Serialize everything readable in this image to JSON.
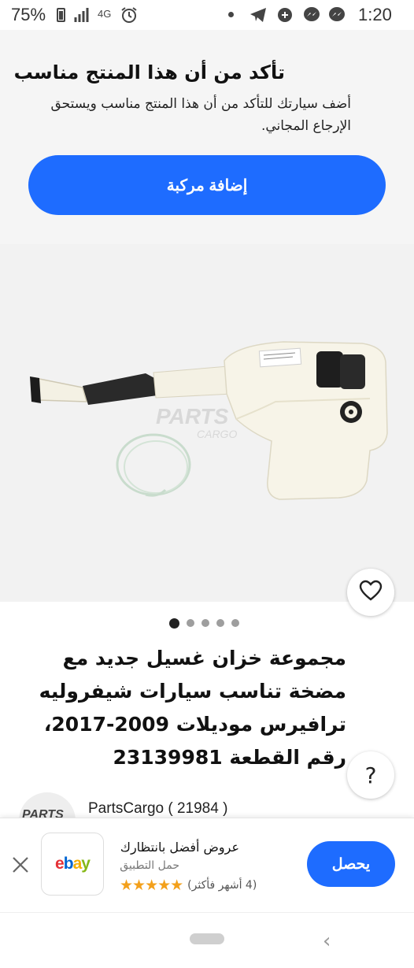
{
  "status_bar": {
    "battery": "75%",
    "network": "4G",
    "time": "1:20"
  },
  "fitment": {
    "title": "تأكد من أن هذا المنتج مناسب",
    "subtitle": "أضف سيارتك للتأكد من أن هذا المنتج مناسب ويستحق الإرجاع المجاني.",
    "add_vehicle_label": "إضافة مركبة"
  },
  "image_watermark": {
    "line1": "PARTS",
    "line2": "CARGO"
  },
  "gallery": {
    "image_count": 5,
    "active_index": 0
  },
  "product": {
    "title": "مجموعة خزان غسيل جديد مع مضخة تناسب سيارات شيفروليه ترافيرس موديلات 2009-2017، رقم القطعة 23139981"
  },
  "seller": {
    "logo_text": "PARTS",
    "name": "PartsCargo ( 21984 )"
  },
  "app_banner": {
    "app_name": "ebay",
    "title": "عروض أفضل بانتظارك",
    "subtitle": "حمل التطبيق",
    "stars": "★★★★★",
    "rating_count": "(4 أشهر فأكثر)",
    "get_label": "يحصل"
  },
  "colors": {
    "accent": "#1e6cff",
    "star": "#f3a01b",
    "ebay_e": "#e53238",
    "ebay_b": "#0064d2",
    "ebay_a": "#f5af02",
    "ebay_y": "#86b817"
  }
}
